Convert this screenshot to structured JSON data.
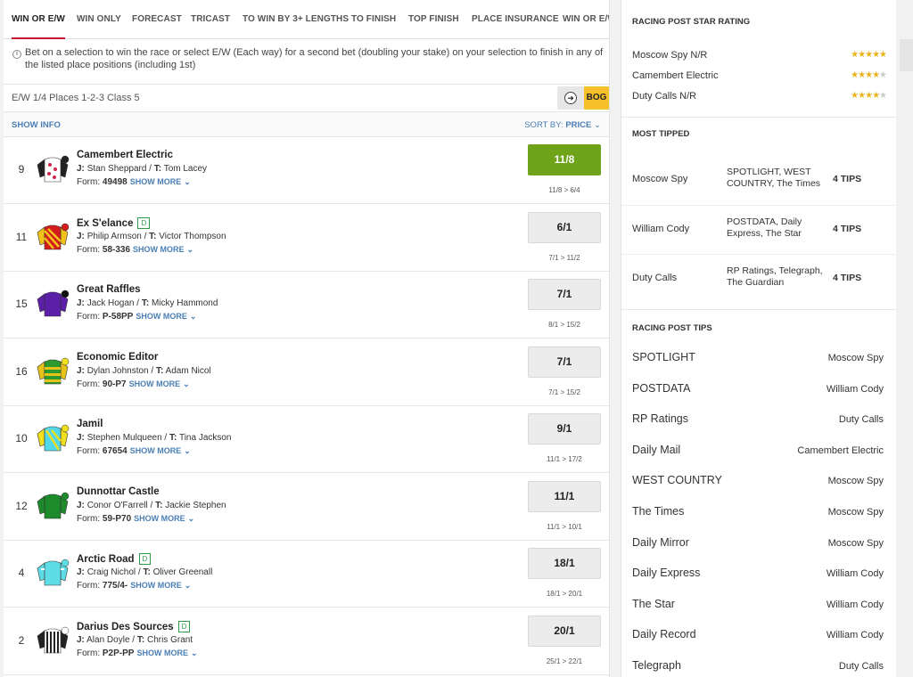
{
  "tabs": [
    "WIN OR E/W",
    "WIN ONLY",
    "FORECAST",
    "TRICAST",
    "TO WIN BY 3+ LENGTHS",
    "TO FINISH",
    "TOP FINISH",
    "PLACE INSURANCE",
    "WIN OR E/W"
  ],
  "info_text": "Bet on a selection to win the race or select E/W (Each way) for a second bet (doubling your stake) on your selection to finish in any of the listed place positions (including 1st)",
  "terms": "E/W 1/4 Places 1-2-3  Class 5",
  "bog_label": "BOG",
  "list": {
    "show_info": "SHOW INFO",
    "sort_by": "SORT BY:",
    "sort_value": "PRICE"
  },
  "show_more": "SHOW MORE",
  "runners": [
    {
      "num": "9",
      "name": "Camembert Electric",
      "d": false,
      "jockey": "Stan Sheppard",
      "trainer": "Tom Lacey",
      "form": "49498",
      "price": "11/8",
      "move": "11/8 > 6/4",
      "fav": true,
      "silk": "spots"
    },
    {
      "num": "11",
      "name": "Ex S'elance",
      "d": true,
      "jockey": "Philip Armson",
      "trainer": "Victor Thompson",
      "form": "58-336",
      "price": "6/1",
      "move": "7/1 > 11/2",
      "fav": false,
      "silk": "redyellow"
    },
    {
      "num": "15",
      "name": "Great Raffles",
      "d": false,
      "jockey": "Jack Hogan",
      "trainer": "Micky Hammond",
      "form": "P-58PP",
      "price": "7/1",
      "move": "8/1 > 15/2",
      "fav": false,
      "silk": "purple"
    },
    {
      "num": "16",
      "name": "Economic Editor",
      "d": false,
      "jockey": "Dylan Johnston",
      "trainer": "Adam Nicol",
      "form": "90-P7",
      "price": "7/1",
      "move": "7/1 > 15/2",
      "fav": false,
      "silk": "hoops"
    },
    {
      "num": "10",
      "name": "Jamil",
      "d": false,
      "jockey": "Stephen Mulqueen",
      "trainer": "Tina Jackson",
      "form": "67654",
      "price": "9/1",
      "move": "11/1 > 17/2",
      "fav": false,
      "silk": "cyanyellow"
    },
    {
      "num": "12",
      "name": "Dunnottar Castle",
      "d": false,
      "jockey": "Conor O'Farrell",
      "trainer": "Jackie Stephen",
      "form": "59-P70",
      "price": "11/1",
      "move": "11/1 > 10/1",
      "fav": false,
      "silk": "green"
    },
    {
      "num": "4",
      "name": "Arctic Road",
      "d": true,
      "jockey": "Craig Nichol",
      "trainer": "Oliver Greenall",
      "form": "775/4-",
      "price": "18/1",
      "move": "18/1 > 20/1",
      "fav": false,
      "silk": "cyan"
    },
    {
      "num": "2",
      "name": "Darius Des Sources",
      "d": true,
      "jockey": "Alan Doyle",
      "trainer": "Chris Grant",
      "form": "P2P-PP",
      "price": "20/1",
      "move": "25/1 > 22/1",
      "fav": false,
      "silk": "stripes"
    }
  ],
  "star_rating": {
    "title": "RACING POST STAR RATING",
    "items": [
      {
        "name": "Moscow Spy N/R",
        "stars": 5
      },
      {
        "name": "Camembert Electric",
        "stars": 4
      },
      {
        "name": "Duty Calls N/R",
        "stars": 4
      }
    ]
  },
  "most_tipped": {
    "title": "MOST TIPPED",
    "items": [
      {
        "name": "Moscow Spy",
        "sources": "SPOTLIGHT, WEST COUNTRY, The Times",
        "count": "4 TIPS"
      },
      {
        "name": "William Cody",
        "sources": "POSTDATA, Daily Express, The Star",
        "count": "4 TIPS"
      },
      {
        "name": "Duty Calls",
        "sources": "RP Ratings, Telegraph, The Guardian",
        "count": "4 TIPS"
      }
    ]
  },
  "rp_tips": {
    "title": "RACING POST TIPS",
    "items": [
      {
        "publication": "SPOTLIGHT",
        "runner": "Moscow Spy"
      },
      {
        "publication": "POSTDATA",
        "runner": "William Cody"
      },
      {
        "publication": "RP Ratings",
        "runner": "Duty Calls"
      },
      {
        "publication": "Daily Mail",
        "runner": "Camembert Electric"
      },
      {
        "publication": "WEST COUNTRY",
        "runner": "Moscow Spy"
      },
      {
        "publication": "The Times",
        "runner": "Moscow Spy"
      },
      {
        "publication": "Daily Mirror",
        "runner": "Moscow Spy"
      },
      {
        "publication": "Daily Express",
        "runner": "William Cody"
      },
      {
        "publication": "The Star",
        "runner": "William Cody"
      },
      {
        "publication": "Daily Record",
        "runner": "William Cody"
      },
      {
        "publication": "Telegraph",
        "runner": "Duty Calls"
      }
    ]
  },
  "colors": {
    "accent": "#c8102e",
    "fav_price": "#6ea31a",
    "link": "#4a7fb5",
    "star": "#e8b21a",
    "bog": "#f6c02a"
  }
}
